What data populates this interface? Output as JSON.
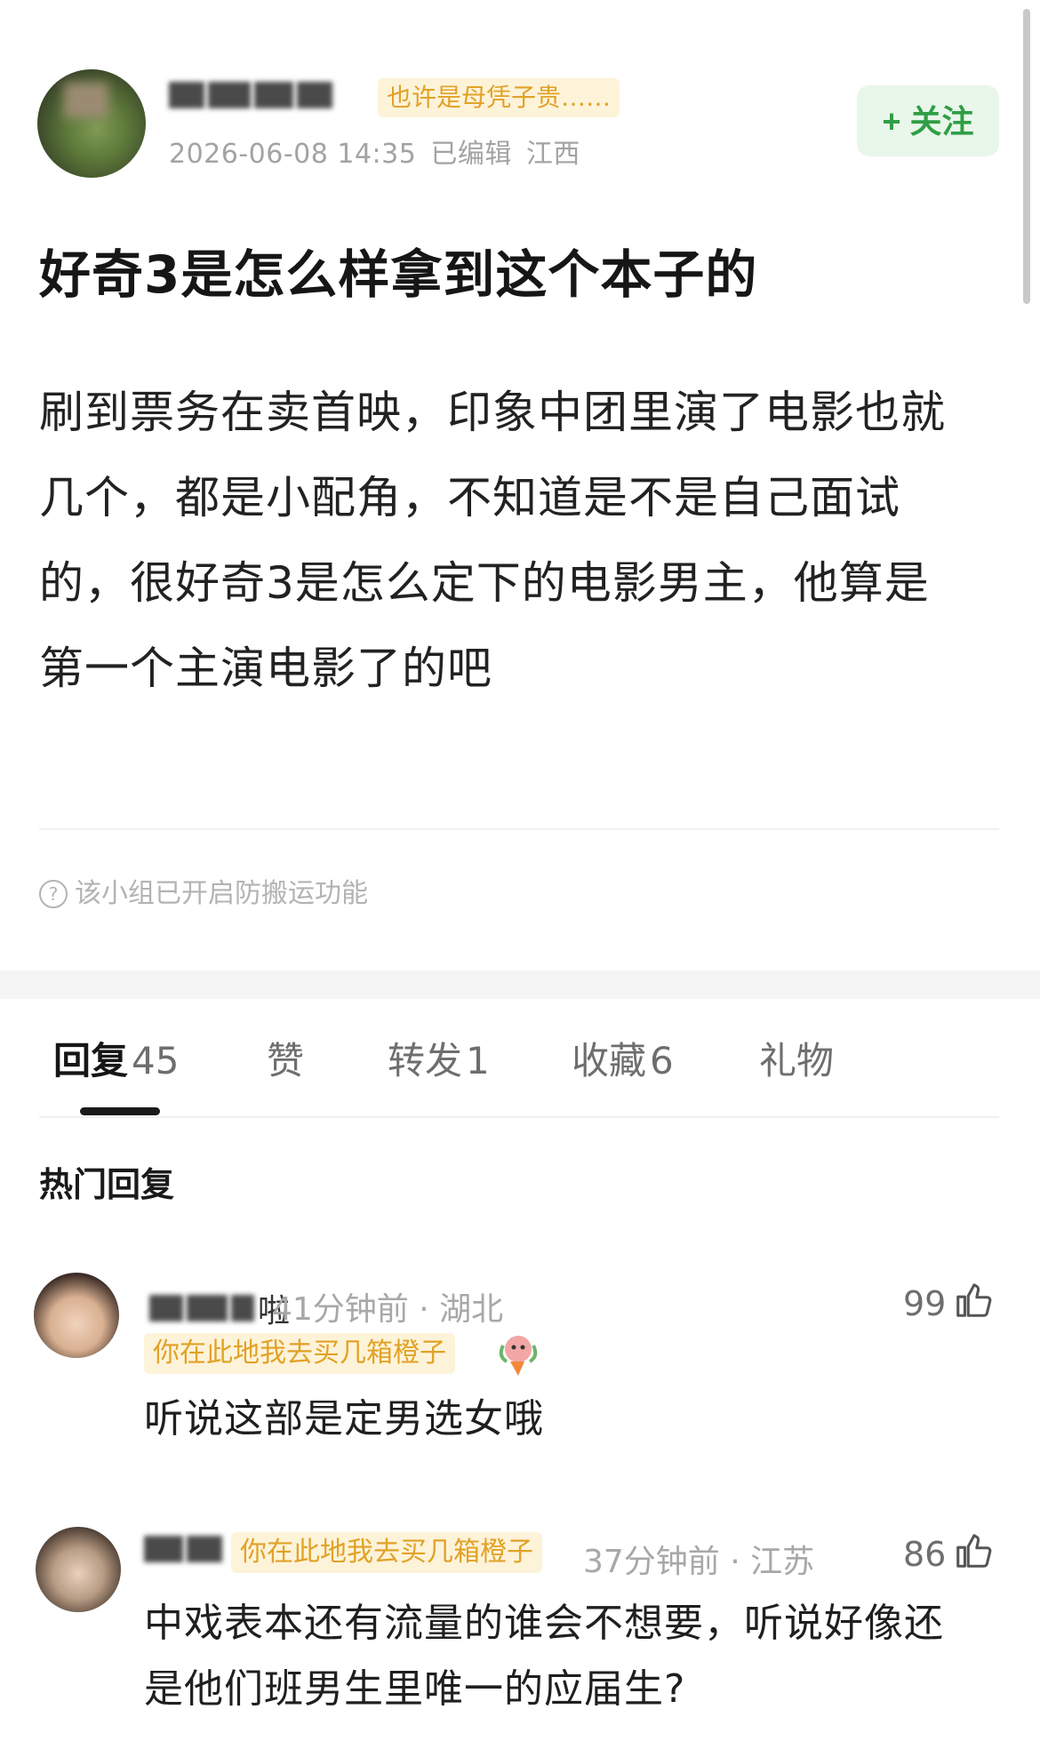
{
  "post": {
    "author": {
      "name_suffix": "",
      "group_tag": "也许是母凭子贵……"
    },
    "timestamp": "2026-06-08 14:35",
    "edited": "已编辑",
    "location": "江西",
    "follow_label": "+ 关注",
    "title": "好奇3是怎么样拿到这个本子的",
    "body_lines": [
      "刷到票务在卖首映，印象中团里演了电影也就",
      "几个，都是小配角，不知道是不是自己面试",
      "的，很好奇3是怎么定下的电影男主，他算是",
      "第一个主演电影了的吧"
    ],
    "notice": "该小组已开启防搬运功能"
  },
  "tabs": [
    {
      "label": "回复",
      "count": "45"
    },
    {
      "label": "赞",
      "count": ""
    },
    {
      "label": "转发",
      "count": "1"
    },
    {
      "label": "收藏",
      "count": "6"
    },
    {
      "label": "礼物",
      "count": ""
    }
  ],
  "hot_replies_title": "热门回复",
  "comments": [
    {
      "name_suffix": "啦",
      "time": "41分钟前",
      "location": "湖北",
      "tag": "你在此地我去买几箱橙子",
      "likes": "99",
      "text_lines": [
        "听说这部是定男选女哦"
      ]
    },
    {
      "name_suffix": "",
      "time": "37分钟前",
      "location": "江苏",
      "tag": "你在此地我去买几箱橙子",
      "likes": "86",
      "text_lines": [
        "中戏表本还有流量的谁会不想要，听说好像还",
        "是他们班男生里唯一的应届生?"
      ]
    }
  ],
  "colors": {
    "accent_green": "#2f9e46",
    "tag_gold": "#e1a226",
    "tag_bg": "#fdf3d9"
  },
  "icons": [
    "question-circle-icon",
    "thumb-up-icon",
    "sticker-icon"
  ]
}
